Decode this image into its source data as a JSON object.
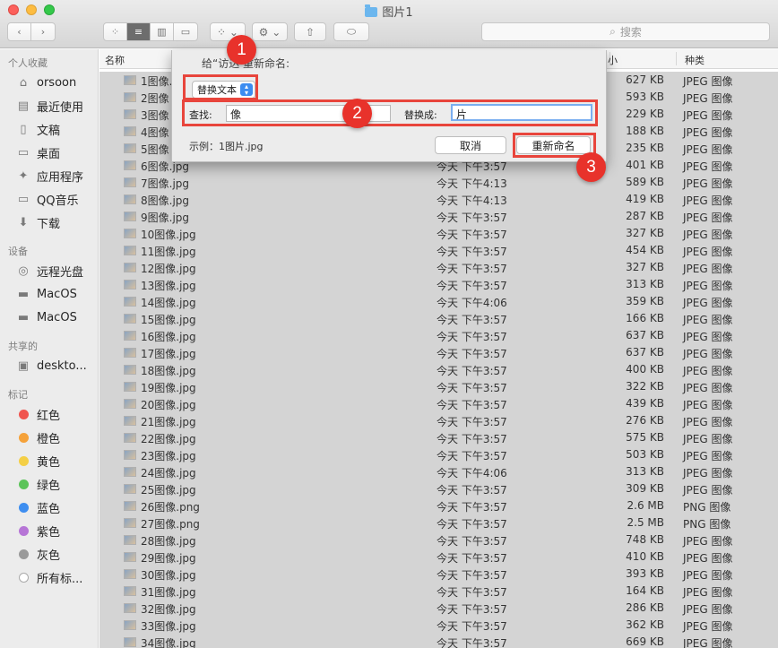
{
  "window": {
    "title": "图片1"
  },
  "search": {
    "placeholder": "搜索"
  },
  "sidebar": {
    "favorites_header": "个人收藏",
    "favorites": [
      {
        "label": "orsoon",
        "icon": "home-icon"
      },
      {
        "label": "最近使用",
        "icon": "recents-icon"
      },
      {
        "label": "文稿",
        "icon": "documents-icon"
      },
      {
        "label": "桌面",
        "icon": "desktop-icon"
      },
      {
        "label": "应用程序",
        "icon": "applications-icon"
      },
      {
        "label": "QQ音乐",
        "icon": "folder-icon"
      },
      {
        "label": "下载",
        "icon": "downloads-icon"
      }
    ],
    "devices_header": "设备",
    "devices": [
      {
        "label": "远程光盘",
        "icon": "disc-icon"
      },
      {
        "label": "MacOS",
        "icon": "drive-icon"
      },
      {
        "label": "MacOS",
        "icon": "drive-icon"
      }
    ],
    "shared_header": "共享的",
    "shared": [
      {
        "label": "deskto...",
        "icon": "monitor-icon"
      }
    ],
    "tags_header": "标记",
    "tags": [
      {
        "label": "红色",
        "color": "#f0554f"
      },
      {
        "label": "橙色",
        "color": "#f5a23a"
      },
      {
        "label": "黄色",
        "color": "#f4cf46"
      },
      {
        "label": "绿色",
        "color": "#5cc45a"
      },
      {
        "label": "蓝色",
        "color": "#3e8ef0"
      },
      {
        "label": "紫色",
        "color": "#b675d6"
      },
      {
        "label": "灰色",
        "color": "#9a9a9a"
      },
      {
        "label": "所有标...",
        "color": "#ffffff"
      }
    ]
  },
  "columns": {
    "name": "名称",
    "size": "小",
    "kind": "种类"
  },
  "files": [
    {
      "name": "1图像.jpg",
      "date": "",
      "size": "627 KB",
      "kind": "JPEG 图像"
    },
    {
      "name": "2图像",
      "date": "",
      "size": "593 KB",
      "kind": "JPEG 图像"
    },
    {
      "name": "3图像",
      "date": "",
      "size": "229 KB",
      "kind": "JPEG 图像"
    },
    {
      "name": "4图像",
      "date": "",
      "size": "188 KB",
      "kind": "JPEG 图像"
    },
    {
      "name": "5图像",
      "date": "",
      "size": "235 KB",
      "kind": "JPEG 图像"
    },
    {
      "name": "6图像.jpg",
      "date": "今天 下午3:57",
      "size": "401 KB",
      "kind": "JPEG 图像"
    },
    {
      "name": "7图像.jpg",
      "date": "今天 下午4:13",
      "size": "589 KB",
      "kind": "JPEG 图像"
    },
    {
      "name": "8图像.jpg",
      "date": "今天 下午4:13",
      "size": "419 KB",
      "kind": "JPEG 图像"
    },
    {
      "name": "9图像.jpg",
      "date": "今天 下午3:57",
      "size": "287 KB",
      "kind": "JPEG 图像"
    },
    {
      "name": "10图像.jpg",
      "date": "今天 下午3:57",
      "size": "327 KB",
      "kind": "JPEG 图像"
    },
    {
      "name": "11图像.jpg",
      "date": "今天 下午3:57",
      "size": "454 KB",
      "kind": "JPEG 图像"
    },
    {
      "name": "12图像.jpg",
      "date": "今天 下午3:57",
      "size": "327 KB",
      "kind": "JPEG 图像"
    },
    {
      "name": "13图像.jpg",
      "date": "今天 下午3:57",
      "size": "313 KB",
      "kind": "JPEG 图像"
    },
    {
      "name": "14图像.jpg",
      "date": "今天 下午4:06",
      "size": "359 KB",
      "kind": "JPEG 图像"
    },
    {
      "name": "15图像.jpg",
      "date": "今天 下午3:57",
      "size": "166 KB",
      "kind": "JPEG 图像"
    },
    {
      "name": "16图像.jpg",
      "date": "今天 下午3:57",
      "size": "637 KB",
      "kind": "JPEG 图像"
    },
    {
      "name": "17图像.jpg",
      "date": "今天 下午3:57",
      "size": "637 KB",
      "kind": "JPEG 图像"
    },
    {
      "name": "18图像.jpg",
      "date": "今天 下午3:57",
      "size": "400 KB",
      "kind": "JPEG 图像"
    },
    {
      "name": "19图像.jpg",
      "date": "今天 下午3:57",
      "size": "322 KB",
      "kind": "JPEG 图像"
    },
    {
      "name": "20图像.jpg",
      "date": "今天 下午3:57",
      "size": "439 KB",
      "kind": "JPEG 图像"
    },
    {
      "name": "21图像.jpg",
      "date": "今天 下午3:57",
      "size": "276 KB",
      "kind": "JPEG 图像"
    },
    {
      "name": "22图像.jpg",
      "date": "今天 下午3:57",
      "size": "575 KB",
      "kind": "JPEG 图像"
    },
    {
      "name": "23图像.jpg",
      "date": "今天 下午3:57",
      "size": "503 KB",
      "kind": "JPEG 图像"
    },
    {
      "name": "24图像.jpg",
      "date": "今天 下午4:06",
      "size": "313 KB",
      "kind": "JPEG 图像"
    },
    {
      "name": "25图像.jpg",
      "date": "今天 下午3:57",
      "size": "309 KB",
      "kind": "JPEG 图像"
    },
    {
      "name": "26图像.png",
      "date": "今天 下午3:57",
      "size": "2.6 MB",
      "kind": "PNG 图像"
    },
    {
      "name": "27图像.png",
      "date": "今天 下午3:57",
      "size": "2.5 MB",
      "kind": "PNG 图像"
    },
    {
      "name": "28图像.jpg",
      "date": "今天 下午3:57",
      "size": "748 KB",
      "kind": "JPEG 图像"
    },
    {
      "name": "29图像.jpg",
      "date": "今天 下午3:57",
      "size": "410 KB",
      "kind": "JPEG 图像"
    },
    {
      "name": "30图像.jpg",
      "date": "今天 下午3:57",
      "size": "393 KB",
      "kind": "JPEG 图像"
    },
    {
      "name": "31图像.jpg",
      "date": "今天 下午3:57",
      "size": "164 KB",
      "kind": "JPEG 图像"
    },
    {
      "name": "32图像.jpg",
      "date": "今天 下午3:57",
      "size": "286 KB",
      "kind": "JPEG 图像"
    },
    {
      "name": "33图像.jpg",
      "date": "今天 下午3:57",
      "size": "362 KB",
      "kind": "JPEG 图像"
    },
    {
      "name": "34图像.jpg",
      "date": "今天 下午3:57",
      "size": "669 KB",
      "kind": "JPEG 图像"
    }
  ],
  "rename_dialog": {
    "title": "给“访达  重新命名:",
    "mode": "替换文本",
    "find_label": "查找:",
    "find_value": "像",
    "replace_label": "替换成:",
    "replace_value": "片",
    "example": "示例：1图片.jpg",
    "cancel": "取消",
    "rename": "重新命名"
  },
  "annotations": [
    "1",
    "2",
    "3"
  ],
  "accent": "#e8453c"
}
